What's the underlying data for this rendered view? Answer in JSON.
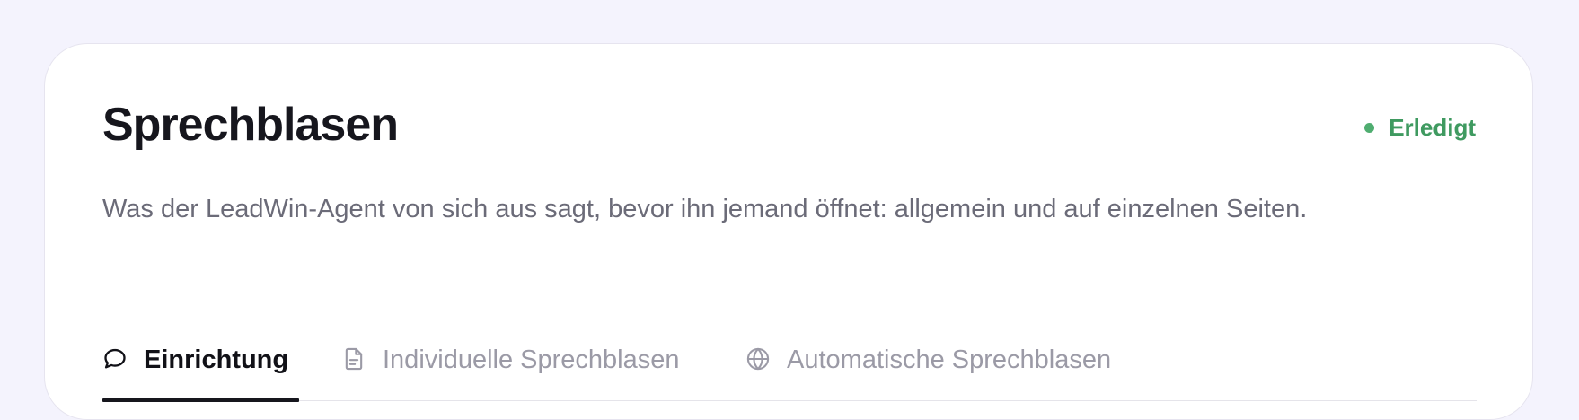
{
  "section": {
    "title": "Sprechblasen",
    "status": "Erledigt",
    "description": "Was der LeadWin-Agent von sich aus sagt, bevor ihn jemand öffnet: allgemein und auf einzelnen Seiten."
  },
  "tabs": [
    {
      "label": "Einrichtung",
      "icon": "chat-bubble-icon",
      "active": true
    },
    {
      "label": "Individuelle Sprechblasen",
      "icon": "document-icon",
      "active": false
    },
    {
      "label": "Automatische Sprechblasen",
      "icon": "globe-icon",
      "active": false
    }
  ],
  "colors": {
    "background": "#f4f3fd",
    "card": "#ffffff",
    "status": "#3f9a60",
    "text_primary": "#16161d",
    "text_secondary": "#6b6b78",
    "tab_inactive": "#9b9aa6"
  }
}
